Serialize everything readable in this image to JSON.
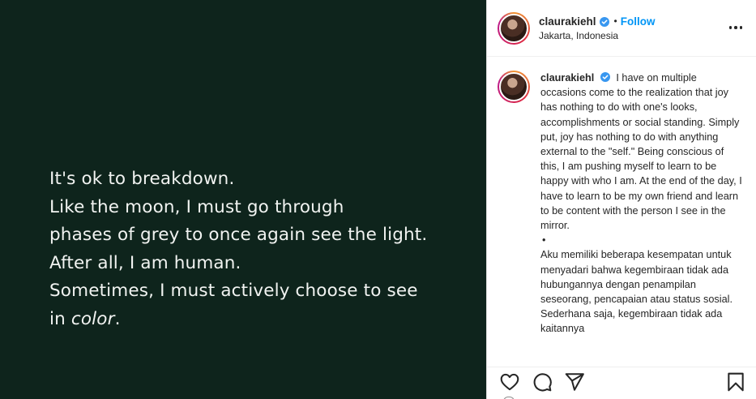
{
  "media": {
    "quote_lines": [
      "It's ok to breakdown.",
      "Like the moon, I must go through",
      "phases of grey to once again see the light.",
      "After all, I am human.",
      "Sometimes, I must actively choose to see"
    ],
    "last_line_prefix": "in ",
    "last_line_italic": "color",
    "last_line_suffix": "."
  },
  "header": {
    "username": "claurakiehl",
    "dot": "•",
    "follow_label": "Follow",
    "location": "Jakarta, Indonesia"
  },
  "caption": {
    "username": "claurakiehl",
    "text_en": "I have on multiple occasions come to the realization that joy has nothing to do with one's looks, accomplishments or social standing. Simply put, joy has nothing to do with anything external to the \"self.\" Being conscious of this, I am pushing myself to learn to be happy with who I am. At the end of the day, I have to learn to be my own friend and learn to be content with the person I see in the mirror.",
    "separator": "•",
    "text_id": "Aku memiliki beberapa kesempatan untuk menyadari bahwa kegembiraan tidak ada hubungannya dengan penampilan seseorang, pencapaian atau status sosial. Sederhana saja, kegembiraan tidak ada kaitannya"
  },
  "icons": {
    "verified": "verified-badge-icon",
    "more": "more-options-icon",
    "like": "heart-icon",
    "comment": "comment-icon",
    "share": "paper-plane-icon",
    "save": "bookmark-icon"
  },
  "colors": {
    "media_bg": "#0e241c",
    "quote_text": "#f1f3f1",
    "accent": "#0095f6",
    "verified": "#3897f0"
  }
}
